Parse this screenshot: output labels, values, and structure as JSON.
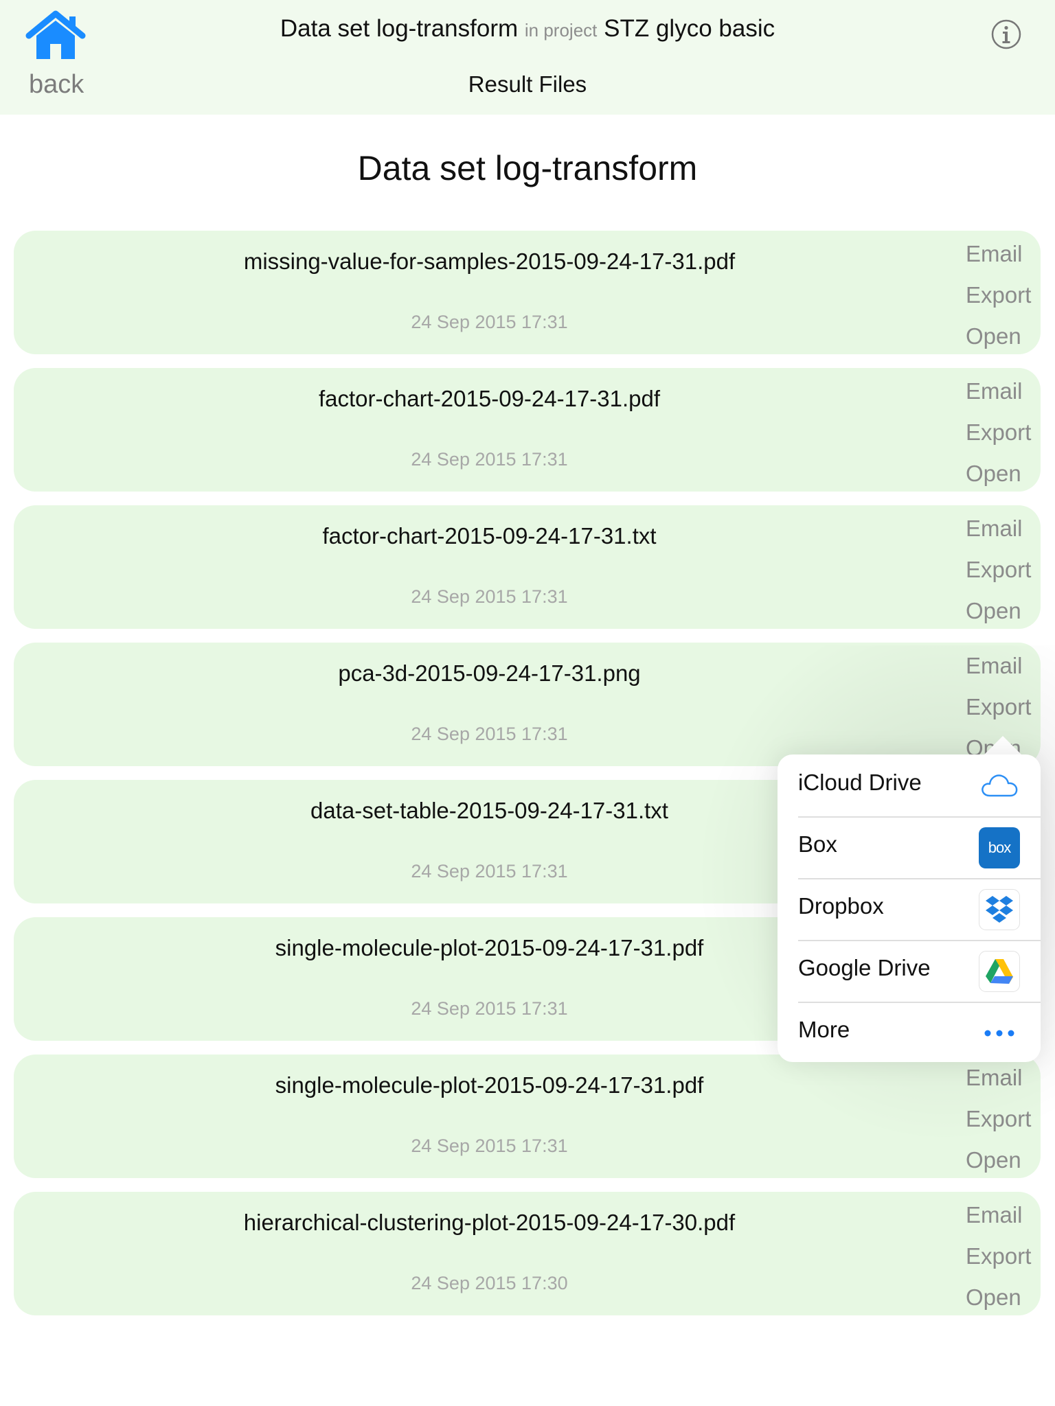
{
  "header": {
    "back_label": "back",
    "dataset_name": "Data set log-transform",
    "in_project_label": "in project",
    "project_name": "STZ glyco basic",
    "subtitle": "Result Files"
  },
  "page": {
    "title": "Data set log-transform"
  },
  "actions": {
    "email": "Email",
    "export": "Export",
    "open": "Open"
  },
  "files": [
    {
      "name": "missing-value-for-samples-2015-09-24-17-31.pdf",
      "date": "24 Sep 2015 17:31"
    },
    {
      "name": "factor-chart-2015-09-24-17-31.pdf",
      "date": "24 Sep 2015 17:31"
    },
    {
      "name": "factor-chart-2015-09-24-17-31.txt",
      "date": "24 Sep 2015 17:31"
    },
    {
      "name": "pca-3d-2015-09-24-17-31.png",
      "date": "24 Sep 2015 17:31"
    },
    {
      "name": "data-set-table-2015-09-24-17-31.txt",
      "date": "24 Sep 2015 17:31"
    },
    {
      "name": "single-molecule-plot-2015-09-24-17-31.pdf",
      "date": "24 Sep 2015 17:31"
    },
    {
      "name": "single-molecule-plot-2015-09-24-17-31.pdf",
      "date": "24 Sep 2015 17:31"
    },
    {
      "name": "hierarchical-clustering-plot-2015-09-24-17-30.pdf",
      "date": "24 Sep 2015 17:30"
    }
  ],
  "export_popover": {
    "items": [
      {
        "label": "iCloud Drive",
        "icon": "icloud-icon"
      },
      {
        "label": "Box",
        "icon": "box-icon",
        "icon_text": "box"
      },
      {
        "label": "Dropbox",
        "icon": "dropbox-icon"
      },
      {
        "label": "Google Drive",
        "icon": "google-drive-icon"
      },
      {
        "label": "More",
        "icon": "more-icon"
      }
    ]
  },
  "colors": {
    "header_bg": "#f1faee",
    "card_bg": "#e7f8e3",
    "home_blue": "#1a8cff",
    "action_gray": "#8b8b8b",
    "date_gray": "#a7a7a7",
    "box_blue": "#1572c6",
    "more_blue": "#1a7cf5"
  }
}
